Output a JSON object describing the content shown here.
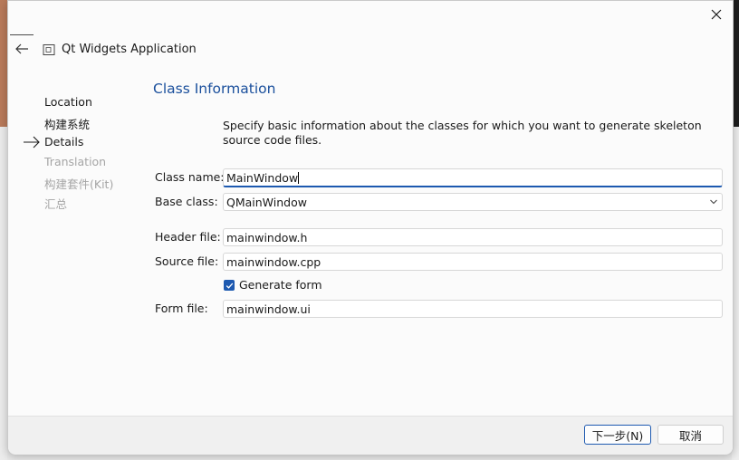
{
  "window": {
    "title": "Qt Widgets Application",
    "close_icon": "close-icon",
    "back_icon": "arrow-left-icon"
  },
  "steps": [
    {
      "label": "Location",
      "state": "done"
    },
    {
      "label": "构建系统",
      "state": "done"
    },
    {
      "label": "Details",
      "state": "current"
    },
    {
      "label": "Translation",
      "state": "future"
    },
    {
      "label": "构建套件(Kit)",
      "state": "future"
    },
    {
      "label": "汇总",
      "state": "future"
    }
  ],
  "page": {
    "title": "Class Information",
    "description": "Specify basic information about the classes for which you want to generate skeleton source code files."
  },
  "form": {
    "class_name_label": "Class name:",
    "class_name_value": "MainWindow",
    "base_class_label": "Base class:",
    "base_class_value": "QMainWindow",
    "header_file_label": "Header file:",
    "header_file_value": "mainwindow.h",
    "source_file_label": "Source file:",
    "source_file_value": "mainwindow.cpp",
    "generate_form_label": "Generate form",
    "generate_form_checked": true,
    "form_file_label": "Form file:",
    "form_file_value": "mainwindow.ui"
  },
  "footer": {
    "next_label": "下一步(N)",
    "cancel_label": "取消"
  },
  "colors": {
    "accent": "#1d59b0",
    "title": "#1a4f9c",
    "disabled_text": "#a5a5a5"
  }
}
